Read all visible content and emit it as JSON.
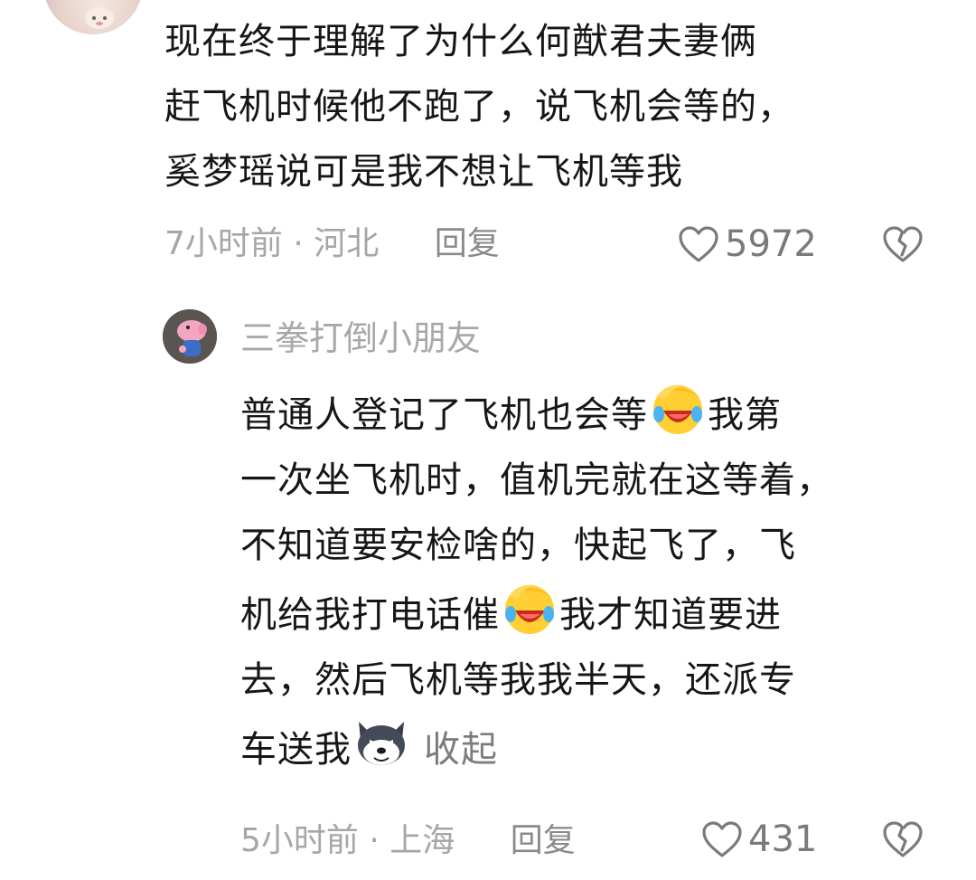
{
  "comment1": {
    "lines": [
      "现在终于理解了为什么何猷君夫妻俩",
      "赶飞机时候他不跑了，说飞机会等的，",
      "奚梦瑶说可是我不想让飞机等我"
    ],
    "time": "7小时前",
    "location": "河北",
    "reply_label": "回复",
    "like_count": "5972"
  },
  "comment2": {
    "username": "三拳打倒小朋友",
    "line1_a": "普通人登记了飞机也会等",
    "line1_b": "我第",
    "line2": "一次坐飞机时，值机完就在这等着，",
    "line3": "不知道要安检啥的，快起飞了，飞",
    "line4_a": "机给我打电话催",
    "line4_b": "我才知道要进",
    "line5": "去，然后飞机等我我半天，还派专",
    "line6_a": "车送我",
    "collapse_label": "收起",
    "time": "5小时前",
    "location": "上海",
    "reply_label": "回复",
    "like_count": "431"
  },
  "icons": {
    "like": "heart-outline-icon",
    "dislike": "broken-heart-icon",
    "emoji_laugh": "facepalm-laugh-emoji",
    "emoji_dog": "husky-dog-emoji"
  },
  "colors": {
    "text": "#161616",
    "meta": "#a6a6a6",
    "username": "#a8a8a8"
  }
}
